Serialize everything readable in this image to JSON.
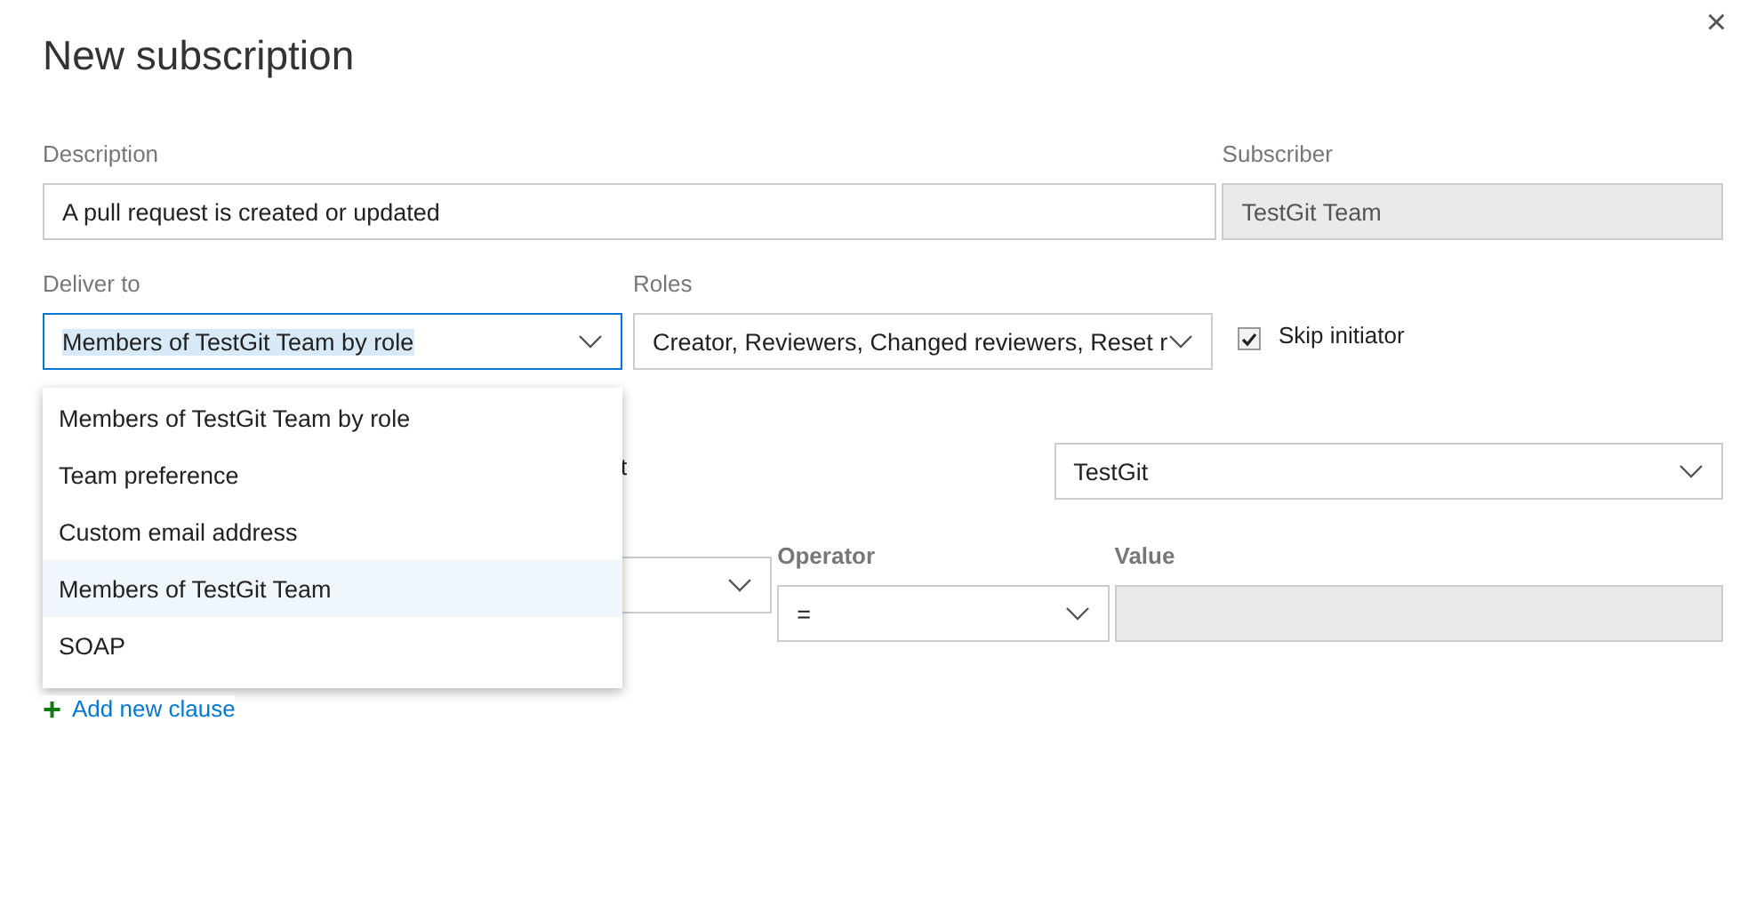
{
  "dialog": {
    "title": "New subscription",
    "close": "×"
  },
  "description": {
    "label": "Description",
    "value": "A pull request is created or updated"
  },
  "subscriber": {
    "label": "Subscriber",
    "value": "TestGit Team",
    "disabled": true
  },
  "deliver_to": {
    "label": "Deliver to",
    "value": "Members of TestGit Team by role",
    "open": true,
    "options": [
      {
        "label": "Members of TestGit Team by role",
        "hovered": false
      },
      {
        "label": "Team preference",
        "hovered": false
      },
      {
        "label": "Custom email address",
        "hovered": false
      },
      {
        "label": "Members of TestGit Team",
        "hovered": true
      },
      {
        "label": "SOAP",
        "hovered": false
      }
    ]
  },
  "roles": {
    "label": "Roles",
    "value": "Creator, Reviewers, Changed reviewers, Reset r"
  },
  "skip_initiator": {
    "label": "Skip initiator",
    "checked": true
  },
  "filter": {
    "label": "t",
    "value": "TestGit"
  },
  "clause": {
    "operator_label": "Operator",
    "value_label": "Value",
    "operator": "="
  },
  "add_clause": {
    "icon": "+",
    "label": "Add new clause"
  }
}
